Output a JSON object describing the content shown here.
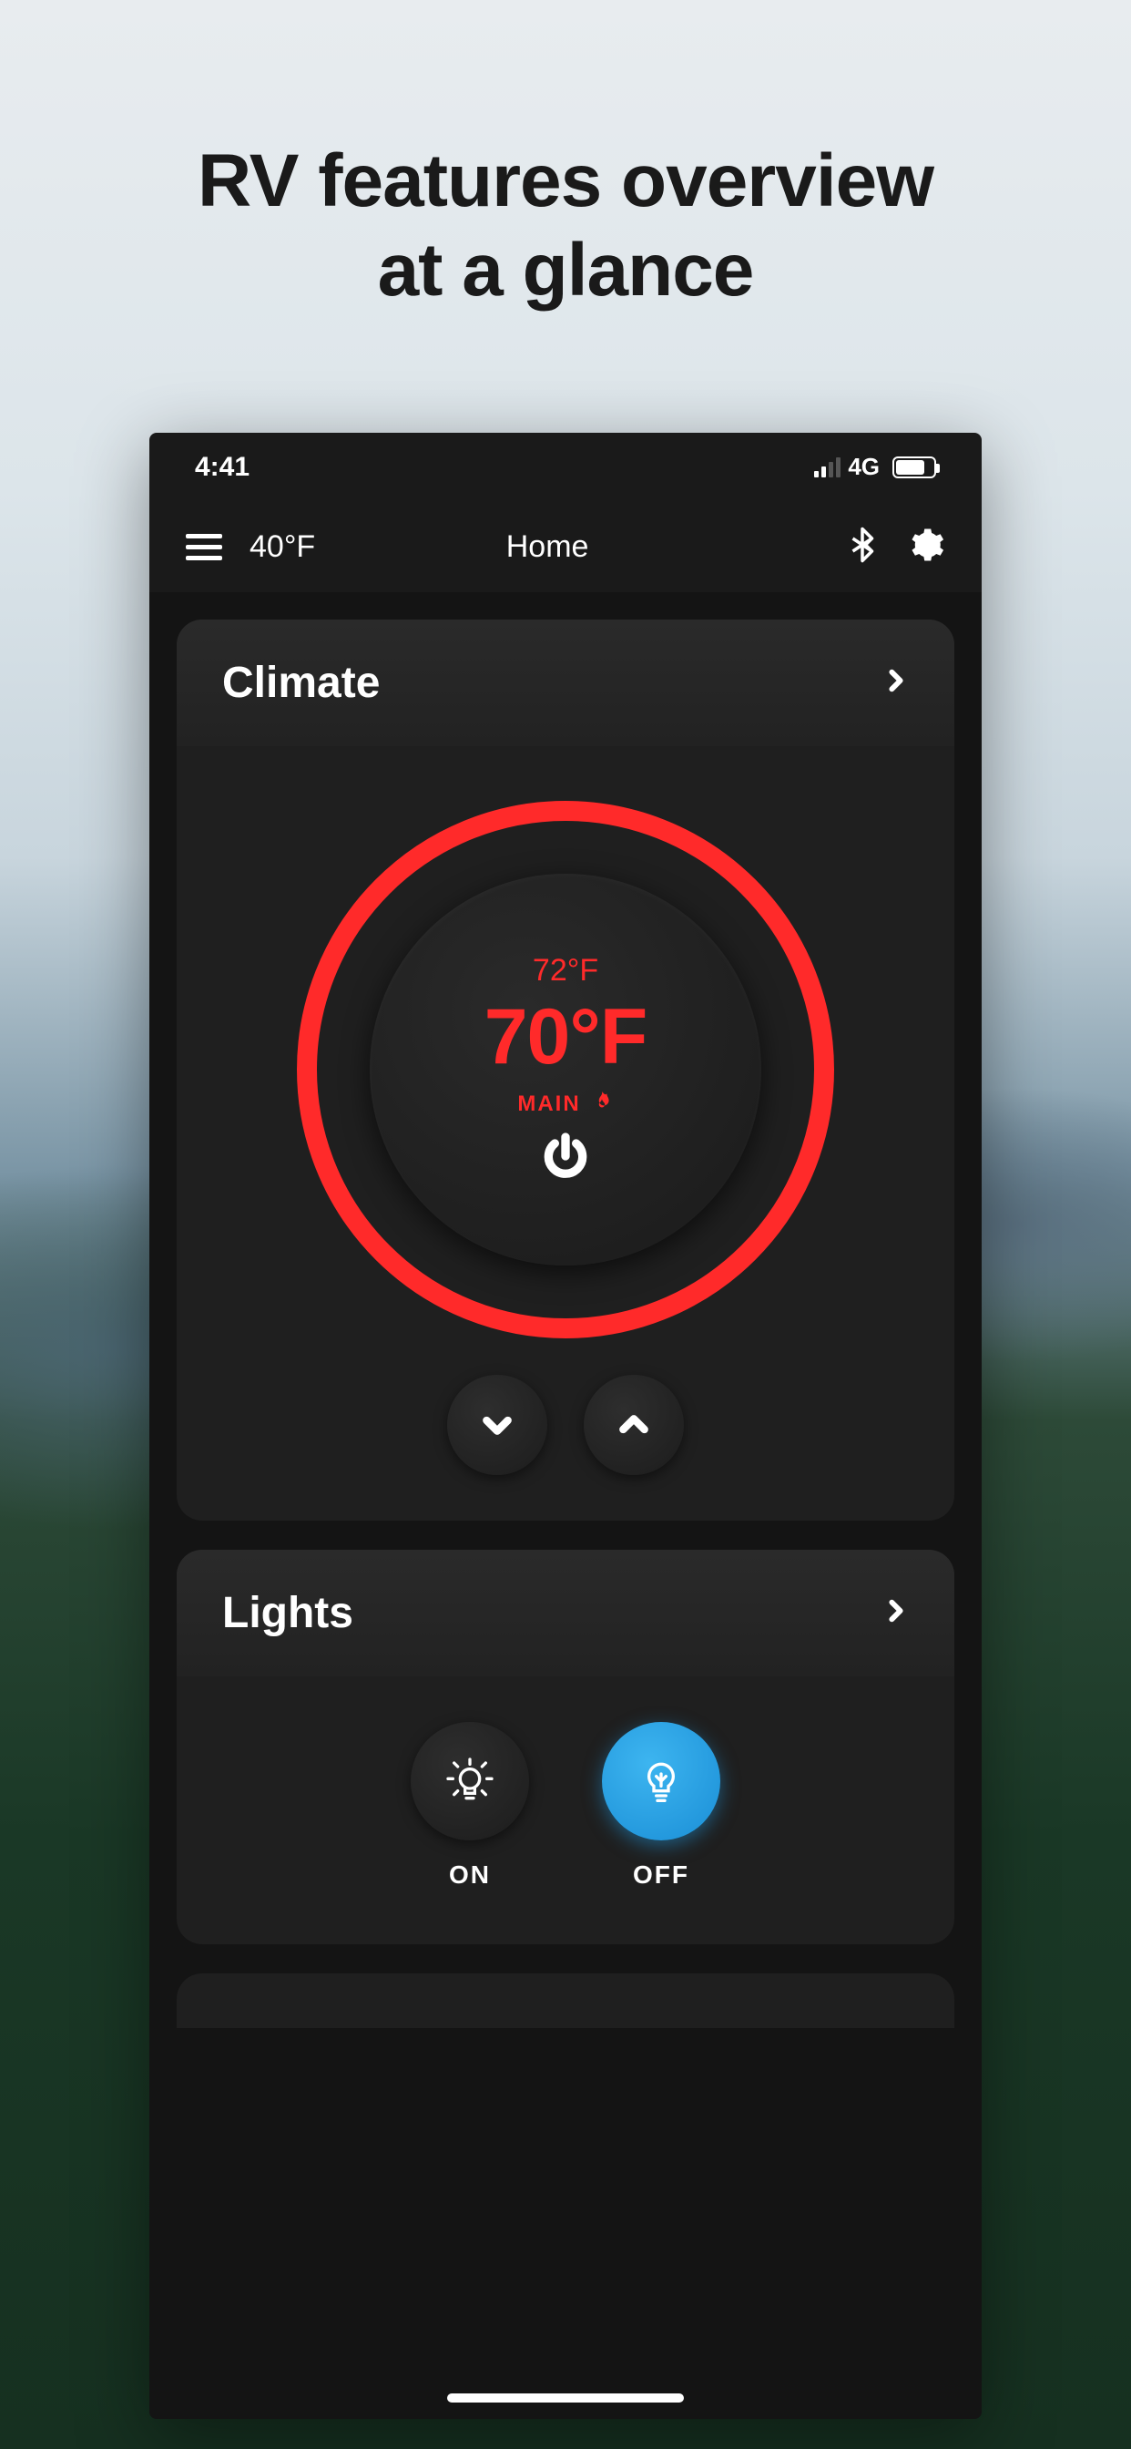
{
  "marketing": {
    "headline_line1": "RV features overview",
    "headline_line2": "at a glance"
  },
  "status": {
    "time": "4:41",
    "network": "4G"
  },
  "header": {
    "outside_temp": "40°F",
    "title": "Home"
  },
  "climate": {
    "title": "Climate",
    "target_temp": "72°F",
    "current_temp": "70°F",
    "zone_label": "MAIN",
    "ring_color": "#ff2a2a"
  },
  "lights": {
    "title": "Lights",
    "on_label": "ON",
    "off_label": "OFF"
  },
  "icons": {
    "menu": "menu-icon",
    "bluetooth": "bluetooth-icon",
    "settings": "gear-icon",
    "chevron_right": "chevron-right-icon",
    "chevron_down": "chevron-down-icon",
    "chevron_up": "chevron-up-icon",
    "flame": "flame-icon",
    "power": "power-icon",
    "bulb": "bulb-icon"
  }
}
